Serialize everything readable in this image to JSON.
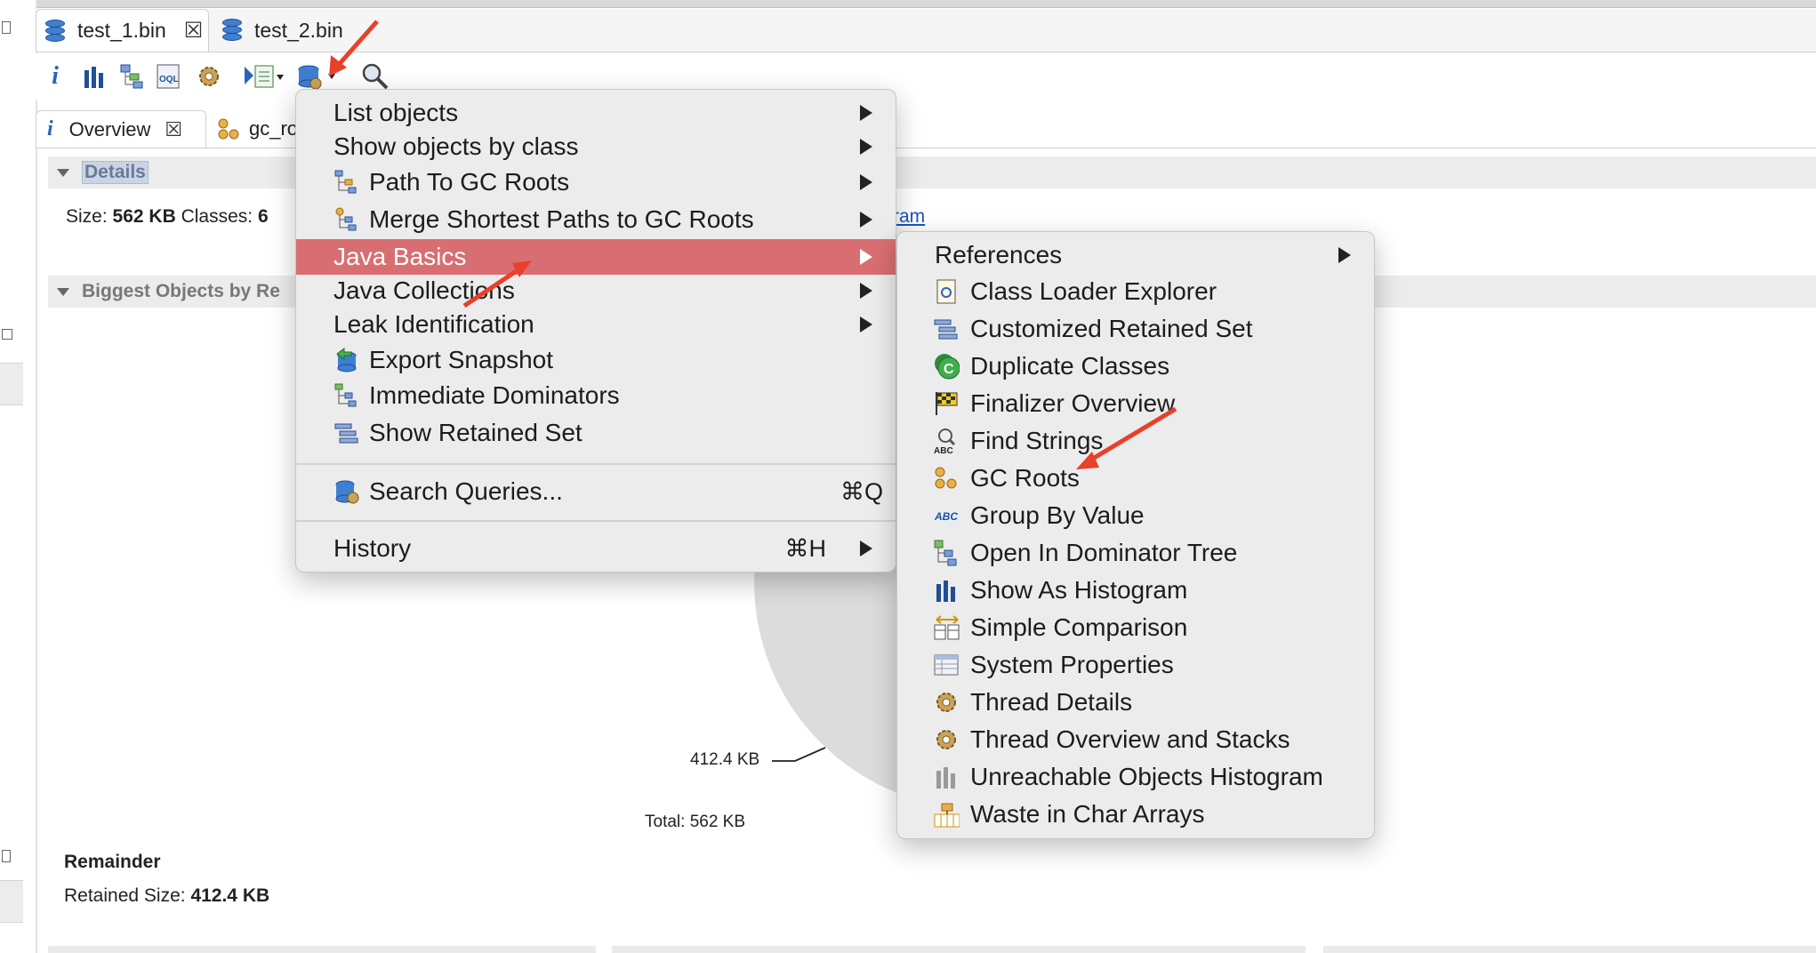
{
  "editor_tabs": [
    {
      "label": "test_1.bin",
      "active": true
    },
    {
      "label": "test_2.bin",
      "active": false
    }
  ],
  "view_tabs": [
    {
      "label": "Overview",
      "active": true
    },
    {
      "label": "gc_ro",
      "active": false
    }
  ],
  "details": {
    "title": "Details",
    "size_label": "Size:",
    "size_value": "562 KB",
    "classes_label": "Classes:",
    "classes_value": "6",
    "histogram_link_fragment": "ram"
  },
  "biggest_objects": {
    "title": "Biggest Objects by Re",
    "pie_label": "412.4 KB",
    "total": "Total: 562 KB"
  },
  "remainder": {
    "title": "Remainder",
    "retained_label": "Retained Size:",
    "retained_value": "412.4 KB"
  },
  "main_menu": {
    "items": [
      {
        "label": "List objects",
        "submenu": true
      },
      {
        "label": "Show objects by class",
        "submenu": true
      },
      {
        "label": "Path To GC Roots",
        "submenu": true,
        "icon": "path-tree-icon"
      },
      {
        "label": "Merge Shortest Paths to GC Roots",
        "submenu": true,
        "icon": "merge-paths-icon"
      },
      {
        "label": "Java Basics",
        "submenu": true,
        "highlighted": true
      },
      {
        "label": "Java Collections",
        "submenu": true
      },
      {
        "label": "Leak Identification",
        "submenu": true
      },
      {
        "label": "Export Snapshot",
        "icon": "export-icon"
      },
      {
        "label": "Immediate Dominators",
        "icon": "dominator-icon"
      },
      {
        "label": "Show Retained Set",
        "icon": "retained-set-icon"
      },
      {
        "label": "Search Queries...",
        "shortcut": "⌘Q",
        "icon": "search-queries-icon"
      },
      {
        "label": "History",
        "shortcut": "⌘H",
        "submenu": true
      }
    ]
  },
  "sub_menu": {
    "items": [
      {
        "label": "References",
        "submenu": true
      },
      {
        "label": "Class Loader Explorer",
        "icon": "class-loader-icon"
      },
      {
        "label": "Customized Retained Set",
        "icon": "retained-set-icon"
      },
      {
        "label": "Duplicate Classes",
        "icon": "duplicate-classes-icon"
      },
      {
        "label": "Finalizer Overview",
        "icon": "finalizer-icon"
      },
      {
        "label": "Find Strings",
        "icon": "find-strings-icon"
      },
      {
        "label": "GC Roots",
        "icon": "gc-roots-icon"
      },
      {
        "label": "Group By Value",
        "icon": "group-by-value-icon"
      },
      {
        "label": "Open In Dominator Tree",
        "icon": "dominator-tree-icon"
      },
      {
        "label": "Show As Histogram",
        "icon": "histogram-icon"
      },
      {
        "label": "Simple Comparison",
        "icon": "comparison-icon"
      },
      {
        "label": "System Properties",
        "icon": "system-properties-icon"
      },
      {
        "label": "Thread Details",
        "icon": "thread-details-icon"
      },
      {
        "label": "Thread Overview and Stacks",
        "icon": "thread-overview-icon"
      },
      {
        "label": "Unreachable Objects Histogram",
        "icon": "unreachable-histogram-icon"
      },
      {
        "label": "Waste in Char Arrays",
        "icon": "char-arrays-icon"
      }
    ]
  },
  "colors": {
    "highlight": "#d96e72",
    "annotation_arrow": "#e8402a",
    "link": "#1a55c8"
  }
}
